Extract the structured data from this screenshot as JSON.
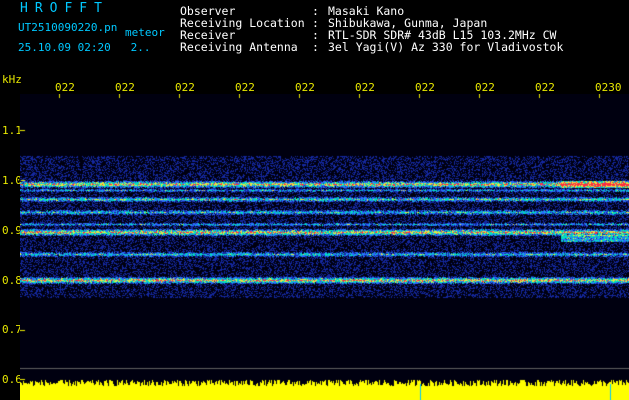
{
  "header": {
    "brand": "HROFFT",
    "filename": "UT2510090220.pn",
    "mode": "meteor",
    "datetime": "25.10.09 02:20",
    "page": "2",
    "info": [
      {
        "key": "Observer",
        "value": "Masaki Kano"
      },
      {
        "key": "Receiving Location",
        "value": "Shibukawa, Gunma, Japan"
      },
      {
        "key": "Receiver",
        "value": "RTL-SDR SDR# 43dB L15 103.2MHz CW"
      },
      {
        "key": "Receiving Antenna",
        "value": "3el Yagi(V) Az 330 for Vladivostok"
      }
    ]
  },
  "axes": {
    "y_unit": "kHz",
    "y_ticks": [
      "1.1",
      "1.0",
      "0.9",
      "0.8",
      "0.7",
      "0.6"
    ],
    "x_ticks": [
      "022",
      "022",
      "022",
      "022",
      "022",
      "022",
      "022",
      "022",
      "022",
      "0230"
    ]
  },
  "colors": {
    "text_info": "#ffffff",
    "text_title": "#00c8ff",
    "axis": "#e8e800",
    "background": "#000000",
    "signal_low": "#1428c8",
    "signal_mid": "#00e0c0",
    "signal_high": "#ff2a40",
    "noise_bar": "#ffff00"
  }
}
